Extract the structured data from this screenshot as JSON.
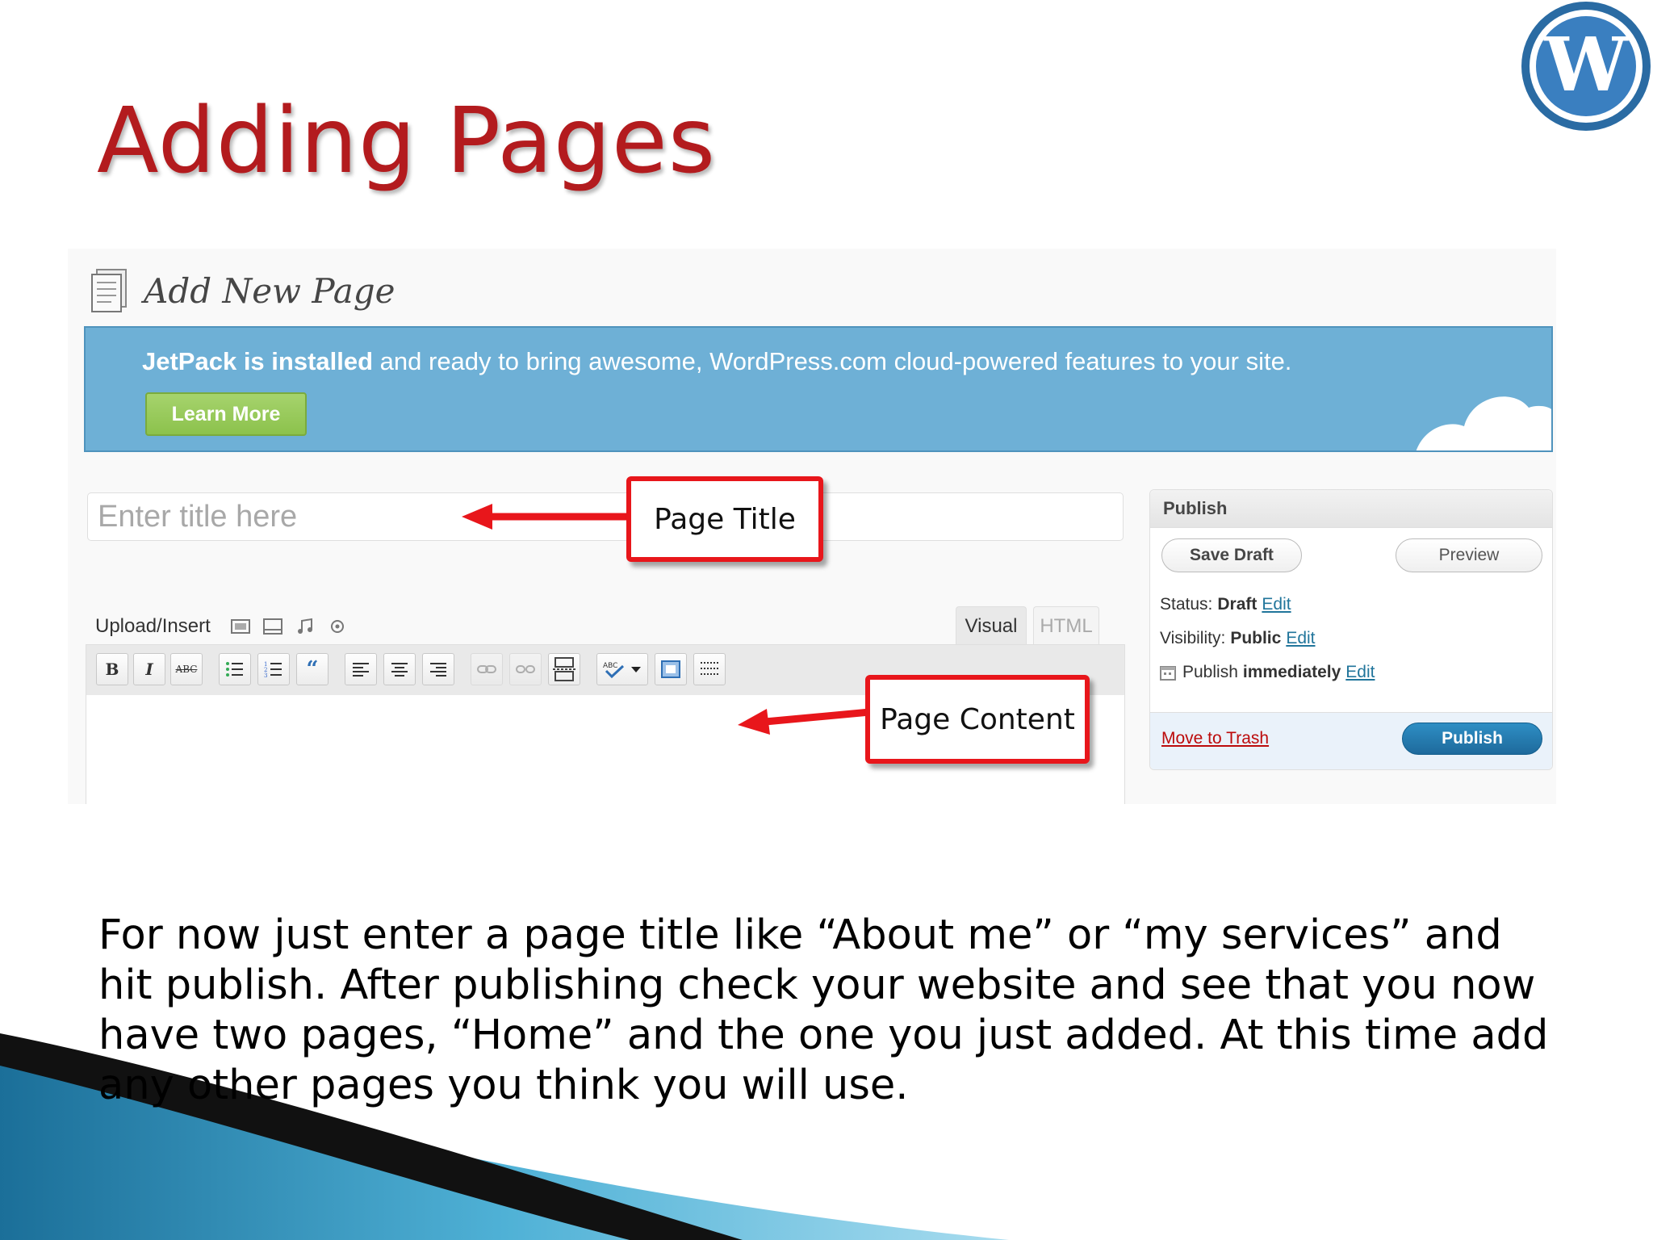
{
  "slide": {
    "title": "Adding Pages",
    "logo_icon": "wordpress-logo-icon",
    "body": "For now just enter a page title like “About me” or “my services” and hit publish.  After publishing check your website and see that you now have two pages, “Home” and the one you just added.  At this time add any other pages you think you will use."
  },
  "screenshot": {
    "page_heading": "Add New Page",
    "notice": {
      "bold": "JetPack is installed",
      "rest": " and ready to bring awesome, WordPress.com cloud-powered features to your site.",
      "button": "Learn More",
      "color": "#6eb0d6"
    },
    "title_input": {
      "placeholder": "Enter title here",
      "value": ""
    },
    "editor": {
      "upload_label": "Upload/Insert",
      "media_icons": [
        "image-icon",
        "video-icon",
        "audio-icon",
        "media-gear-icon"
      ],
      "tabs": [
        "Visual",
        "HTML"
      ],
      "active_tab": "Visual",
      "toolbar_icons": [
        "bold-icon",
        "italic-icon",
        "strikethrough-icon",
        "bullet-list-icon",
        "numbered-list-icon",
        "blockquote-icon",
        "align-left-icon",
        "align-center-icon",
        "align-right-icon",
        "link-icon",
        "unlink-icon",
        "more-tag-icon",
        "spellcheck-icon",
        "fullscreen-icon",
        "kitchen-sink-icon"
      ]
    },
    "publish": {
      "heading": "Publish",
      "save_draft": "Save Draft",
      "preview": "Preview",
      "status_label": "Status:",
      "status_value": "Draft",
      "visibility_label": "Visibility:",
      "visibility_value": "Public",
      "schedule_label": "Publish",
      "schedule_value": "immediately",
      "edit_link": "Edit",
      "trash": "Move to Trash",
      "publish_button": "Publish",
      "accent": "#21759b"
    }
  },
  "callouts": {
    "title": "Page Title",
    "content": "Page Content",
    "color": "#e8161b"
  }
}
